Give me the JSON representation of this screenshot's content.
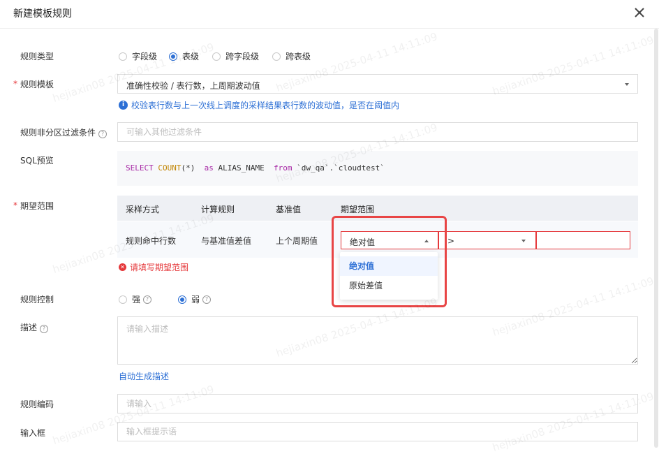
{
  "dialog": {
    "title": "新建模板规则"
  },
  "form": {
    "rule_type": {
      "label": "规则类型",
      "options": [
        "字段级",
        "表级",
        "跨字段级",
        "跨表级"
      ],
      "selected": "表级"
    },
    "rule_template": {
      "label": "规则模板",
      "value": "准确性校验 / 表行数，上周期波动值",
      "hint": "校验表行数与上一次线上调度的采样结果表行数的波动值，是否在阈值内"
    },
    "filter": {
      "label": "规则非分区过滤条件",
      "placeholder": "可输入其他过滤条件"
    },
    "sql_preview": {
      "label": "SQL预览",
      "code": [
        "SELECT",
        "COUNT",
        "(*)  ",
        "as",
        " ALIAS_NAME  ",
        "from",
        " `dw_qa`.`cloudtest`"
      ]
    },
    "expected_range": {
      "label": "期望范围",
      "headers": [
        "采样方式",
        "计算规则",
        "基准值",
        "期望范围"
      ],
      "row": [
        "规则命中行数",
        "与基准值差值",
        "上个周期值"
      ],
      "range_type": "绝对值",
      "operator": ">",
      "dropdown_options": [
        "绝对值",
        "原始差值"
      ],
      "error": "请填写期望范围"
    },
    "control": {
      "label": "规则控制",
      "options": [
        "强",
        "弱"
      ],
      "selected": "弱"
    },
    "description": {
      "label": "描述",
      "placeholder": "请输入描述",
      "auto_link": "自动生成描述"
    },
    "code": {
      "label": "规则编码",
      "placeholder": "请输入"
    },
    "input_box": {
      "label": "输入框",
      "placeholder": "输入框提示语"
    }
  },
  "watermark": "hejiaxin08 2025-04-11 14:11:09",
  "colors": {
    "primary": "#2c6fd5",
    "error": "#e5383b",
    "highlight": "#e84545"
  }
}
